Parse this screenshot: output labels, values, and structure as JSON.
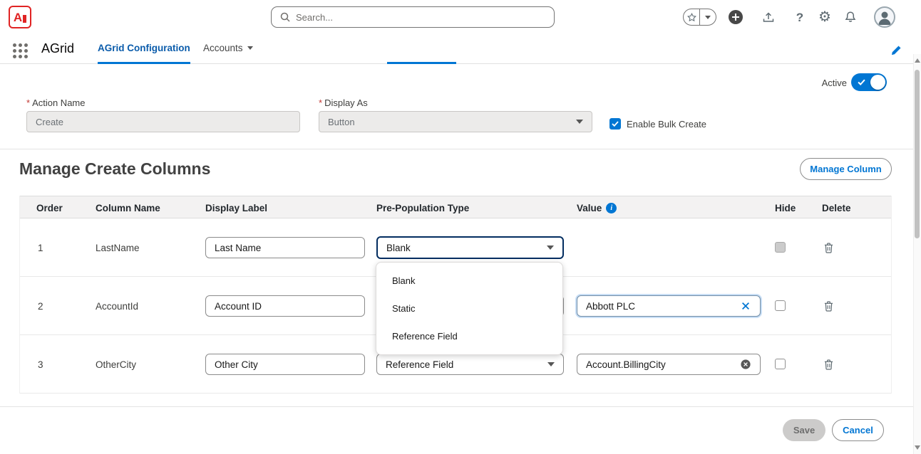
{
  "header": {
    "logo_letter": "A",
    "search": {
      "placeholder": "Search..."
    }
  },
  "glyphs": {
    "question": "?",
    "gear": "⚙",
    "info": "i"
  },
  "nav": {
    "app_name": "AGrid",
    "tabs": [
      {
        "label": "AGrid Configuration",
        "active": true
      },
      {
        "label": "Accounts",
        "active": false
      }
    ]
  },
  "detail": {
    "active_label": "Active",
    "fields": {
      "action_name": {
        "required_mark": "*",
        "label": "Action Name",
        "value": "Create"
      },
      "display_as": {
        "required_mark": "*",
        "label": "Display As",
        "value": "Button"
      },
      "enable_bulk_create": {
        "label": "Enable Bulk Create",
        "checked": true
      }
    }
  },
  "section": {
    "title": "Manage Create Columns",
    "manage_column_button": "Manage Column"
  },
  "table": {
    "headers": {
      "order": "Order",
      "column_name": "Column Name",
      "display_label": "Display Label",
      "pre_population_type": "Pre-Population Type",
      "value": "Value",
      "hide": "Hide",
      "delete": "Delete"
    },
    "rows": [
      {
        "order": "1",
        "column_name": "LastName",
        "display_label": "Last Name",
        "type": "Blank",
        "value": ""
      },
      {
        "order": "2",
        "column_name": "AccountId",
        "display_label": "Account ID",
        "type": "",
        "value": "Abbott PLC"
      },
      {
        "order": "3",
        "column_name": "OtherCity",
        "display_label": "Other City",
        "type": "Reference Field",
        "value": "Account.BillingCity"
      }
    ]
  },
  "type_menu": {
    "options": [
      "Blank",
      "Static",
      "Reference Field"
    ]
  },
  "footer": {
    "save": "Save",
    "cancel": "Cancel"
  },
  "colors": {
    "accent": "#0176d3",
    "tab_text": "#0b5cab",
    "brand_red": "#e02424",
    "focus_border": "#032d60"
  }
}
